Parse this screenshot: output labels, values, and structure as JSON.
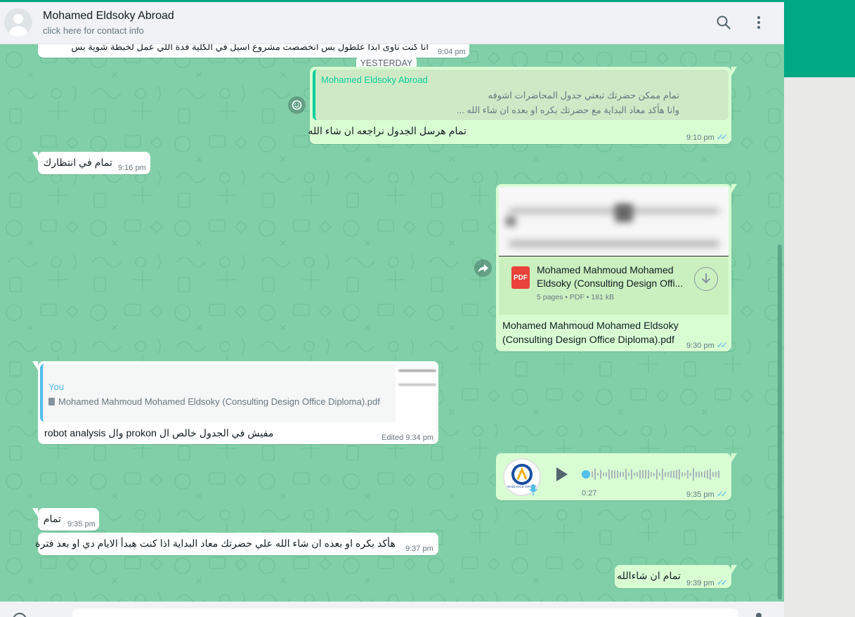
{
  "header": {
    "contact_name": "Mohamed Eldsoky Abroad",
    "subtitle": "click here for contact info",
    "icons": [
      "search-icon",
      "menu-icon"
    ]
  },
  "day_divider": "YESTERDAY",
  "messages": {
    "m0": {
      "text": "انا كنت ناوى ابدا علطول بس انخصصت مشروع اسيل في الكلية فدة اللي عمل لخبطة شوية بس",
      "time": "9:04 pm"
    },
    "m1": {
      "quote_author": "Mohamed Eldsoky Abroad",
      "quote_line1": "تمام ممكن حضرتك تبعتي جدول المحاضرات اشوفه",
      "quote_line2": "وانا هأكد معاد البداية مع حضرتك بكره او بعده ان شاء الله ...",
      "text": "تمام هرسل الجدول نراجعه ان شاء الله",
      "time": "9:10 pm"
    },
    "m2": {
      "text": "تمام في انتظارك",
      "time": "9:16 pm"
    },
    "m3": {
      "doc_title": "Mohamed Mahmoud Mohamed Eldsoky (Consulting Design Offi...",
      "doc_title_l1": "Mohamed Mahmoud Mohamed",
      "doc_title_l2": "Eldsoky (Consulting Design Offi...",
      "doc_meta": "5 pages • PDF • 181 kB",
      "doc_icon_label": "PDF",
      "caption_l1": "Mohamed Mahmoud Mohamed Eldsoky",
      "caption_l2": "(Consulting Design Office Diploma).pdf",
      "time": "9:30 pm"
    },
    "m4": {
      "quote_author": "You",
      "quote_text": "Mohamed Mahmoud Mohamed Eldsoky (Consulting Design Office Diploma).pdf",
      "text": "مفيش في الجدول خالص ال prokon وال robot analysis",
      "time": "Edited 9:34 pm"
    },
    "m5": {
      "duration": "0:27",
      "time": "9:35 pm",
      "avatar_label": "RADIANCE GROUP"
    },
    "m6": {
      "text": "تمام",
      "time": "9:35 pm"
    },
    "m7": {
      "text": "هأكد بكره او بعده ان شاء الله علي حضرتك معاد البداية اذا كنت هبدأ الايام دي او بعد فترة",
      "time": "9:37 pm"
    },
    "m8": {
      "text": "تمام ان شاءالله",
      "time": "9:39 pm"
    }
  },
  "colors": {
    "accent": "#00a884",
    "chat_bg": "#80cfa8",
    "outgoing_bubble": "#d9fdd3",
    "incoming_bubble": "#ffffff",
    "read_ticks": "#53bdeb",
    "pdf_red": "#e8423a"
  }
}
